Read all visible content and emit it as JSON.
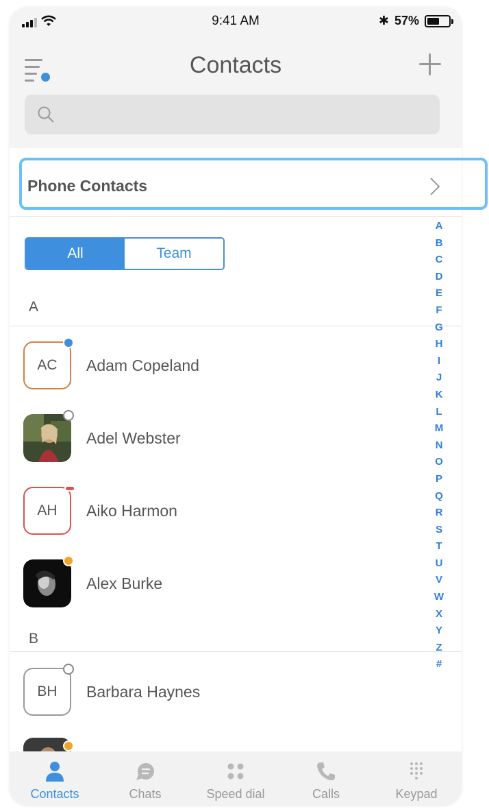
{
  "status_bar": {
    "time": "9:41 AM",
    "battery": "57%",
    "battery_level": 0.57
  },
  "header": {
    "title": "Contacts"
  },
  "search": {
    "placeholder": ""
  },
  "phone_contacts": {
    "label": "Phone Contacts"
  },
  "segments": {
    "all": "All",
    "team": "Team",
    "selected": "All"
  },
  "sections": [
    {
      "letter": "A",
      "contacts": [
        {
          "name": "Adam Copeland",
          "initials": "AC",
          "status": "available",
          "avatar_border": "#d5803f"
        },
        {
          "name": "Adel Webster",
          "initials": "",
          "status": "offline",
          "avatar_photo": true
        },
        {
          "name": "Aiko Harmon",
          "initials": "AH",
          "status": "busy",
          "avatar_border": "#d9534f"
        },
        {
          "name": "Alex Burke",
          "initials": "",
          "status": "away",
          "avatar_photo": true
        }
      ]
    },
    {
      "letter": "B",
      "contacts": [
        {
          "name": "Barbara Haynes",
          "initials": "BH",
          "status": "offline",
          "avatar_border": "#999999"
        }
      ]
    }
  ],
  "alpha_index": [
    "A",
    "B",
    "C",
    "D",
    "E",
    "F",
    "G",
    "H",
    "I",
    "J",
    "K",
    "L",
    "M",
    "N",
    "O",
    "P",
    "Q",
    "R",
    "S",
    "T",
    "U",
    "V",
    "W",
    "X",
    "Y",
    "Z",
    "#"
  ],
  "tabs": [
    {
      "label": "Contacts",
      "icon": "person-icon",
      "active": true
    },
    {
      "label": "Chats",
      "icon": "chat-icon",
      "active": false
    },
    {
      "label": "Speed dial",
      "icon": "speed-dial-icon",
      "active": false
    },
    {
      "label": "Calls",
      "icon": "phone-icon",
      "active": false
    },
    {
      "label": "Keypad",
      "icon": "keypad-icon",
      "active": false
    }
  ],
  "colors": {
    "accent": "#3e8fde",
    "available": "#3e8fde",
    "busy": "#d9534f",
    "away": "#f0a52a",
    "highlight": "#6cc0f5"
  }
}
